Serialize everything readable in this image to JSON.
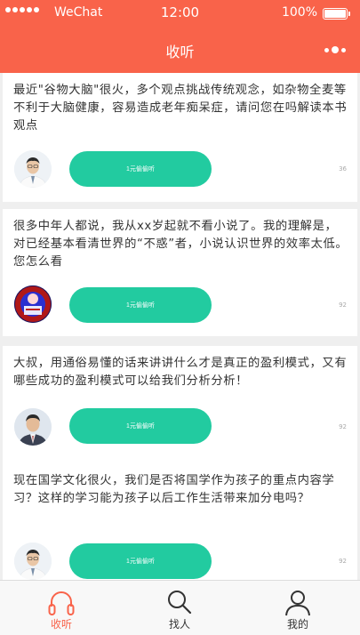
{
  "status_bar": {
    "carrier": "WeChat",
    "time": "12:00",
    "battery": "100%"
  },
  "nav": {
    "title": "收听"
  },
  "questions": [
    {
      "text": "最近\"谷物大脑\"很火，多个观点挑战传统观念，如杂物全麦等不利于大脑健康，容易造成老年痴呆症，请问您在吗解读本书观点",
      "button": "1元偷偷听",
      "count": "36"
    },
    {
      "text": "很多中年人都说，我从xx岁起就不看小说了。我的理解是，对已经基本看清世界的“不惑”者，小说认识世界的效率太低。您怎么看",
      "button": "1元偷偷听",
      "count": "92"
    },
    {
      "text": "大叔，用通俗易懂的话来讲讲什么才是真正的盈利模式，又有哪些成功的盈利模式可以给我们分析分析！",
      "button": "1元偷偷听",
      "count": "92"
    },
    {
      "text": "现在国学文化很火，我们是否将国学作为孩子的重点内容学习？这样的学习能为孩子以后工作生活带来加分电吗？",
      "button": "1元偷偷听",
      "count": "92"
    }
  ],
  "tabs": [
    {
      "label": "收听",
      "icon": "headphones-icon"
    },
    {
      "label": "找人",
      "icon": "search-icon"
    },
    {
      "label": "我的",
      "icon": "user-icon"
    }
  ],
  "colors": {
    "brand": "#f9634a",
    "button": "#22cba0"
  }
}
